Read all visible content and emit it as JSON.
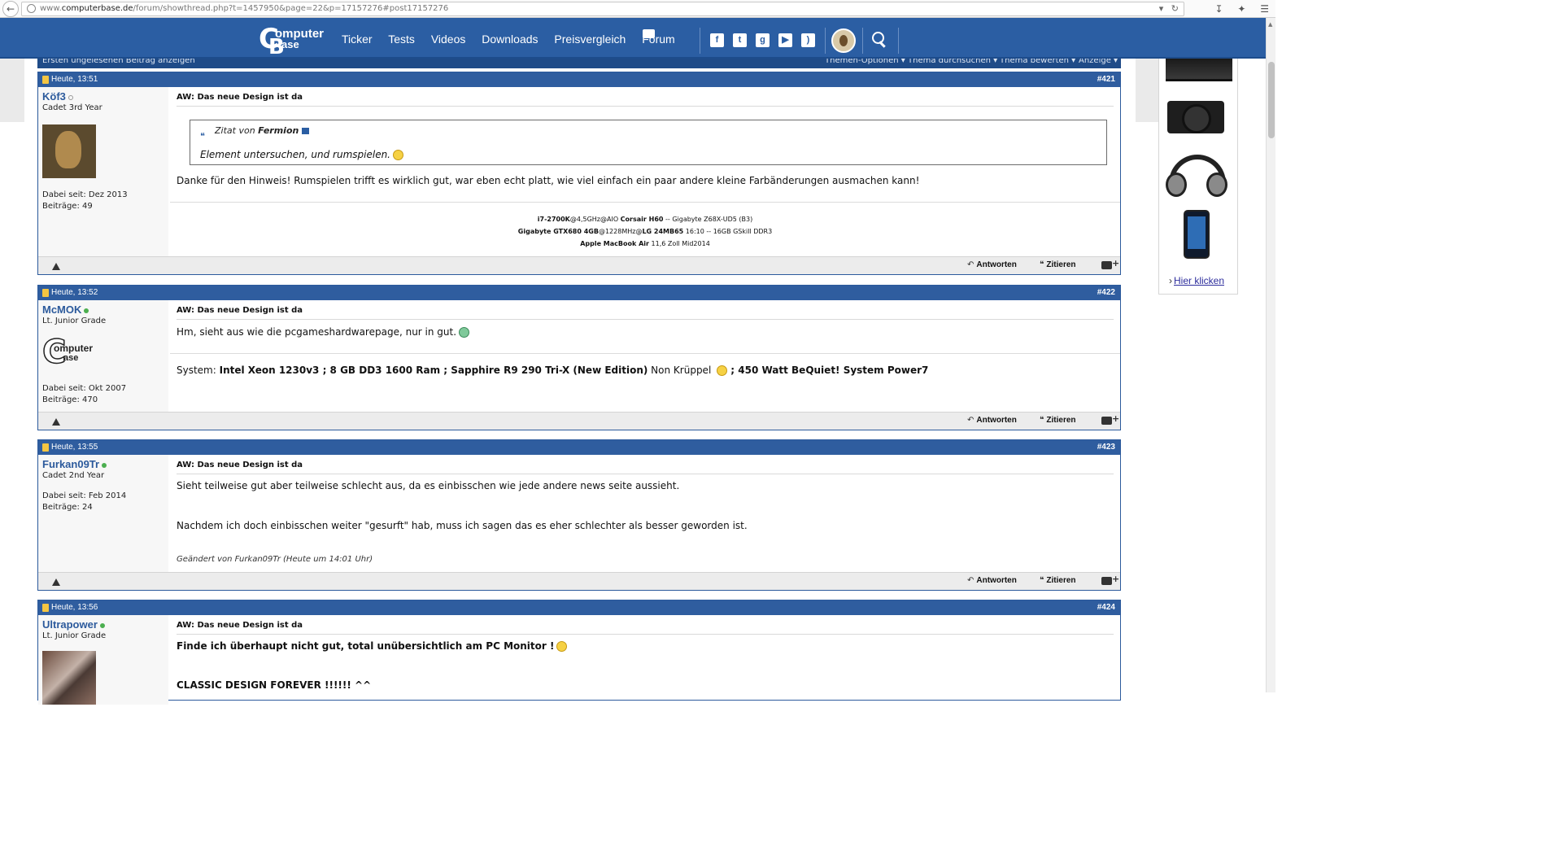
{
  "browser": {
    "url_prefix": "www.",
    "url_domain": "computerbase.de",
    "url_path": "/forum/showthread.php?t=1457950&page=22&p=17157276#post17157276"
  },
  "header": {
    "logo_top": "omputer",
    "logo_bottom": "ase",
    "nav": [
      "Ticker",
      "Tests",
      "Videos",
      "Downloads",
      "Preisvergleich",
      "Forum"
    ],
    "social_icons": [
      "facebook-icon",
      "twitter-icon",
      "google-plus-icon",
      "youtube-icon",
      "rss-icon"
    ]
  },
  "thread_toolbar": {
    "first_unread": "Ersten ungelesenen Beitrag anzeigen",
    "menus": [
      "Themen-Optionen",
      "Thema durchsuchen",
      "Thema bewerten",
      "Anzeige"
    ]
  },
  "footer_labels": {
    "reply": "Antworten",
    "quote": "Zitieren"
  },
  "posts": [
    {
      "date": "Heute, 13:51",
      "number": "#421",
      "username": "Köf3",
      "rank": "Cadet 3rd Year",
      "joined": "Dabei seit: Dez 2013",
      "posts": "Beiträge: 49",
      "title": "AW: Das neue Design ist da",
      "quote_prefix": "Zitat von",
      "quote_author": "Fermion",
      "quote_text": "Element untersuchen, und rumspielen.",
      "body": "Danke für den Hinweis! Rumspielen trifft es wirklich gut, war eben echt platt, wie viel einfach ein paar andere kleine Farbänderungen ausmachen kann!",
      "sig_line1_a": "i7-2700K",
      "sig_line1_b": "@4,5GHz@AIO ",
      "sig_line1_c": "Corsair H60",
      "sig_line1_d": " -- Gigabyte Z68X-UD5 (B3)",
      "sig_line2_a": "Gigabyte GTX680 4GB",
      "sig_line2_b": "@1228MHz@",
      "sig_line2_c": "LG 24MB65",
      "sig_line2_d": " 16:10 -- 16GB GSkill DDR3",
      "sig_line3_a": "Apple MacBook Air",
      "sig_line3_b": " 11,6 Zoll Mid2014"
    },
    {
      "date": "Heute, 13:52",
      "number": "#422",
      "username": "McMOK",
      "rank": "Lt. Junior Grade",
      "joined": "Dabei seit: Okt 2007",
      "posts": "Beiträge: 470",
      "title": "AW: Das neue Design ist da",
      "body": "Hm, sieht aus wie die pcgameshardwarepage, nur in gut.",
      "sig_prefix": "System: ",
      "sig_bold1": "Intel Xeon 1230v3 ; 8 GB DD3 1600 Ram ; Sapphire R9 290 Tri-X (New Edition)",
      "sig_normal": " Non Krüppel ",
      "sig_bold2": " ; 450 Watt BeQuiet! System Power7",
      "avatar_c": "C",
      "avatar_t1": "omputer",
      "avatar_t2": "ase"
    },
    {
      "date": "Heute, 13:55",
      "number": "#423",
      "username": "Furkan09Tr",
      "rank": "Cadet 2nd Year",
      "joined": "Dabei seit: Feb 2014",
      "posts": "Beiträge: 24",
      "title": "AW: Das neue Design ist da",
      "body1": "Sieht teilweise gut aber teilweise schlecht aus, da es einbisschen wie jede andere news seite aussieht.",
      "body2": "Nachdem ich doch einbisschen weiter \"gesurft\" hab, muss ich sagen das es eher schlechter als besser geworden ist.",
      "edited": "Geändert von Furkan09Tr (Heute um 14:01 Uhr)"
    },
    {
      "date": "Heute, 13:56",
      "number": "#424",
      "username": "Ultrapower",
      "rank": "Lt. Junior Grade",
      "title": "AW: Das neue Design ist da",
      "body1": "Finde ich überhaupt nicht gut, total unübersichtlich am PC Monitor !",
      "body2": "CLASSIC DESIGN FOREVER !!!!!! ^^"
    }
  ],
  "sidebar": {
    "link": "Hier klicken"
  },
  "colors": {
    "header_blue": "#2b5ea3",
    "post_head_blue": "#2f5d9f",
    "username_blue": "#2c5a9c",
    "online_green": "#4caf50"
  }
}
